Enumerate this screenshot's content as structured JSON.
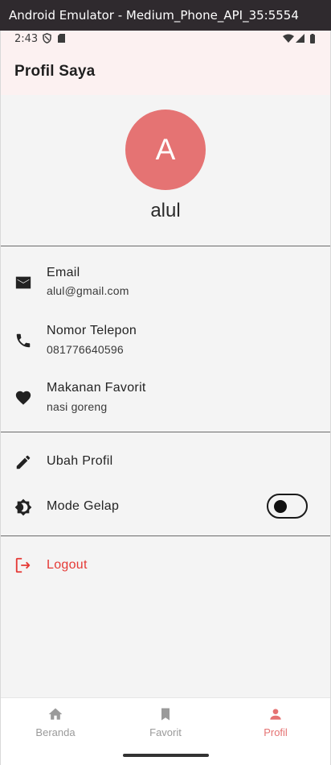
{
  "window": {
    "title": "Android Emulator - Medium_Phone_API_35:5554"
  },
  "status_bar": {
    "time": "2:43",
    "icons_left": [
      "shield-icon",
      "sd-card-icon"
    ],
    "icons_right": [
      "wifi-icon",
      "signal-icon",
      "battery-icon"
    ]
  },
  "app_bar": {
    "title": "Profil Saya"
  },
  "profile": {
    "avatar_initial": "A",
    "name": "alul",
    "avatar_color": "#e57373"
  },
  "info": [
    {
      "icon": "mail-icon",
      "label": "Email",
      "value": "alul@gmail.com"
    },
    {
      "icon": "phone-icon",
      "label": "Nomor Telepon",
      "value": "081776640596"
    },
    {
      "icon": "heart-icon",
      "label": "Makanan Favorit",
      "value": "nasi goreng"
    }
  ],
  "settings": {
    "edit_profile": {
      "icon": "edit-icon",
      "label": "Ubah Profil"
    },
    "dark_mode": {
      "icon": "brightness-icon",
      "label": "Mode Gelap",
      "enabled": false
    }
  },
  "logout": {
    "icon": "logout-icon",
    "label": "Logout",
    "color": "#e53935"
  },
  "bottom_nav": {
    "items": [
      {
        "icon": "home-icon",
        "label": "Beranda",
        "active": false
      },
      {
        "icon": "bookmark-icon",
        "label": "Favorit",
        "active": false
      },
      {
        "icon": "person-icon",
        "label": "Profil",
        "active": true
      }
    ],
    "active_color": "#e57373",
    "inactive_color": "#9a9a9a"
  }
}
